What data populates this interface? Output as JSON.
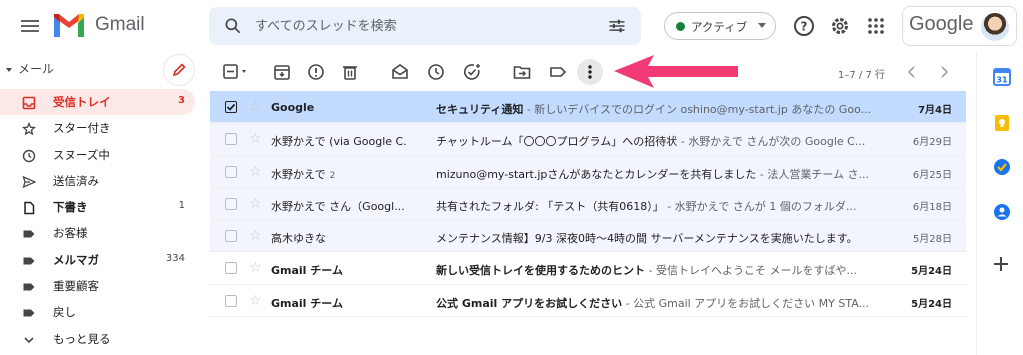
{
  "header": {
    "brand": "Gmail",
    "search_placeholder": "すべてのスレッドを検索",
    "status": "アクティブ",
    "google_word": "Google"
  },
  "sidebar": {
    "section": "メール",
    "items": [
      {
        "label": "受信トレイ",
        "count": "3",
        "icon": "inbox-icon"
      },
      {
        "label": "スター付き",
        "count": "",
        "icon": "star-icon"
      },
      {
        "label": "スヌーズ中",
        "count": "",
        "icon": "clock-icon"
      },
      {
        "label": "送信済み",
        "count": "",
        "icon": "send-icon"
      },
      {
        "label": "下書き",
        "count": "1",
        "icon": "draft-icon"
      },
      {
        "label": "お客様",
        "count": "",
        "icon": "label-icon"
      },
      {
        "label": "メルマガ",
        "count": "334",
        "icon": "label-icon"
      },
      {
        "label": "重要顧客",
        "count": "",
        "icon": "label-icon"
      },
      {
        "label": "戻し",
        "count": "",
        "icon": "label-icon"
      },
      {
        "label": "もっと見る",
        "count": "",
        "icon": "chevron-down-icon"
      }
    ]
  },
  "toolbar": {
    "pager": "1–7 / 7 行",
    "accent_arrow_color": "#f23a75"
  },
  "emails": [
    {
      "sender": "Google",
      "count": "",
      "subject": "セキュリティ通知",
      "snippet": " - 新しいデバイスでのログイン oshino@my-start.jp あなたの Goo...",
      "date": "7月4日",
      "unread": true,
      "selected": true
    },
    {
      "sender": "水野かえで (via Google C.",
      "count": "",
      "subject": "チャットルーム「〇〇〇プログラム」への招待状",
      "snippet": " - 水野かえで さんが次の Google C...",
      "date": "6月29日",
      "unread": false,
      "selected": false
    },
    {
      "sender": "水野かえで",
      "count": "2",
      "subject": "mizuno@my-start.jpさんがあなたとカレンダーを共有しました",
      "snippet": " - 法人営業チーム さ...",
      "date": "6月25日",
      "unread": false,
      "selected": false
    },
    {
      "sender": "水野かえで さん（Googl...",
      "count": "",
      "subject": "共有されたフォルダ: 「テスト（共有0618）」",
      "snippet": " - 水野かえで さんが 1 個のフォルダ...",
      "date": "6月18日",
      "unread": false,
      "selected": false
    },
    {
      "sender": "高木ゆきな",
      "count": "",
      "subject": "メンテナンス情報】9/3 深夜0時〜4時の間 サーバーメンテナンスを実施いたします。",
      "snippet": "",
      "date": "5月28日",
      "unread": false,
      "selected": false
    },
    {
      "sender": "Gmail チーム",
      "count": "",
      "subject": "新しい受信トレイを使用するためのヒント",
      "snippet": " - 受信トレイへようこそ メールをすばや...",
      "date": "5月24日",
      "unread": true,
      "selected": false
    },
    {
      "sender": "Gmail チーム",
      "count": "",
      "subject": "公式 Gmail アプリをお試しください",
      "snippet": " - 公式 Gmail アプリをお試しください MY STA...",
      "date": "5月24日",
      "unread": true,
      "selected": false
    }
  ]
}
